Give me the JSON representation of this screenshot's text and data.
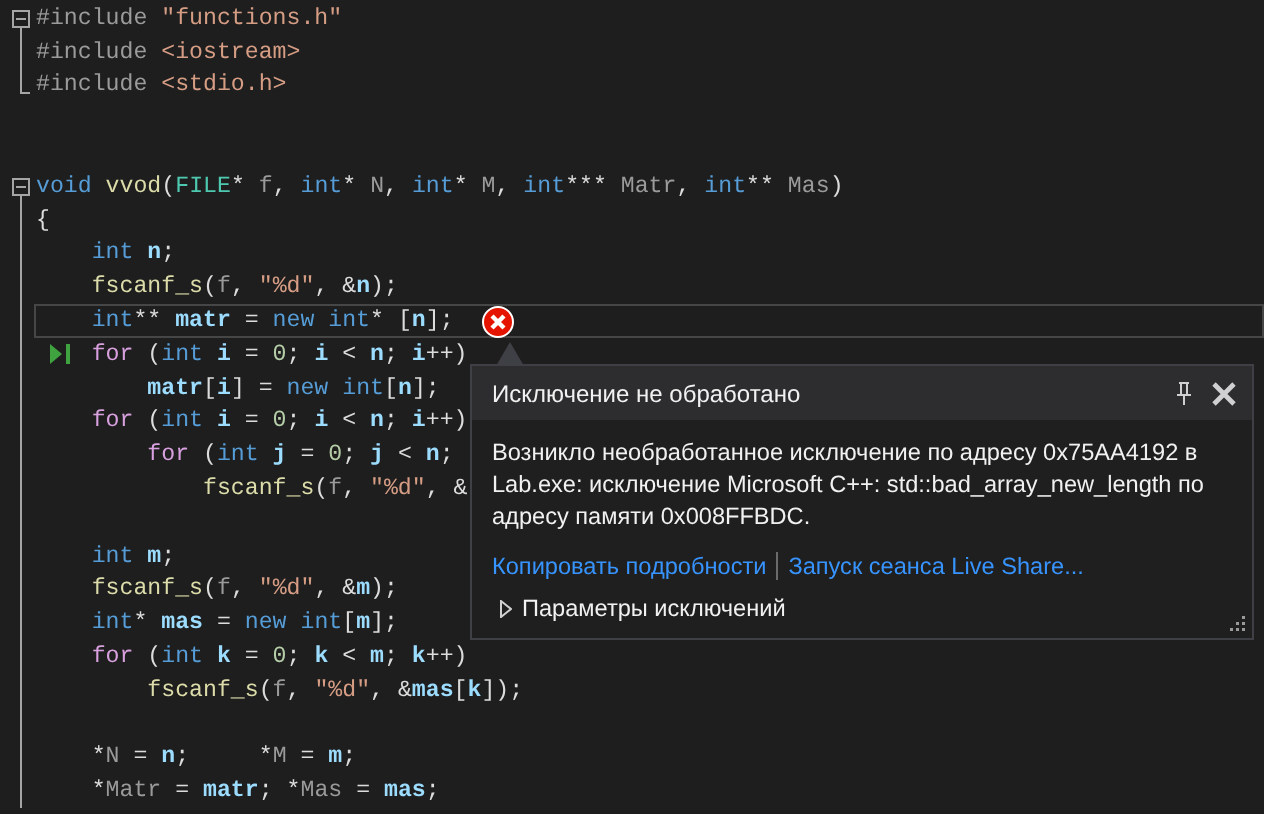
{
  "editor": {
    "lines": [
      {
        "fold": true,
        "guide": true,
        "guide_end": false,
        "highlighted": false,
        "next": false,
        "error": false,
        "tokens": [
          {
            "kind": "pre",
            "text": "#include"
          },
          {
            "kind": "str",
            "text": " \"functions.h\""
          }
        ]
      },
      {
        "fold": false,
        "guide": true,
        "guide_end": false,
        "highlighted": false,
        "next": false,
        "error": false,
        "tokens": [
          {
            "kind": "pre",
            "text": "#include"
          },
          {
            "kind": "str",
            "text": " <iostream>"
          }
        ]
      },
      {
        "fold": false,
        "guide": true,
        "guide_end": true,
        "highlighted": false,
        "next": false,
        "error": false,
        "tokens": [
          {
            "kind": "pre",
            "text": "#include"
          },
          {
            "kind": "str",
            "text": " <stdio.h>"
          }
        ]
      },
      {
        "fold": false,
        "guide": false,
        "guide_end": false,
        "highlighted": false,
        "next": false,
        "error": false
      },
      {
        "fold": false,
        "guide": false,
        "guide_end": false,
        "highlighted": false,
        "next": false,
        "error": false
      },
      {
        "fold": true,
        "guide": true,
        "guide_end": false,
        "highlighted": false,
        "next": false,
        "error": false,
        "tokens": [
          {
            "kind": "kw",
            "text": "void"
          },
          {
            "kind": "fn",
            "text": " vvod"
          },
          {
            "kind": "plain",
            "text": "("
          },
          {
            "kind": "type",
            "text": "FILE"
          },
          {
            "kind": "plain",
            "text": "*"
          },
          {
            "kind": "param",
            "text": " f"
          },
          {
            "kind": "plain",
            "text": ","
          },
          {
            "kind": "kw",
            "text": " int"
          },
          {
            "kind": "plain",
            "text": "*"
          },
          {
            "kind": "param",
            "text": " N"
          },
          {
            "kind": "plain",
            "text": ","
          },
          {
            "kind": "kw",
            "text": " int"
          },
          {
            "kind": "plain",
            "text": "*"
          },
          {
            "kind": "param",
            "text": " M"
          },
          {
            "kind": "plain",
            "text": ","
          },
          {
            "kind": "kw",
            "text": " int"
          },
          {
            "kind": "plain",
            "text": "***"
          },
          {
            "kind": "param",
            "text": " Matr"
          },
          {
            "kind": "plain",
            "text": ","
          },
          {
            "kind": "kw",
            "text": " int"
          },
          {
            "kind": "plain",
            "text": "**"
          },
          {
            "kind": "param",
            "text": " Mas"
          },
          {
            "kind": "plain",
            "text": ")"
          }
        ]
      },
      {
        "fold": false,
        "guide": true,
        "guide_end": false,
        "highlighted": false,
        "next": false,
        "error": false,
        "tokens": [
          {
            "kind": "plain",
            "text": "{"
          }
        ]
      },
      {
        "fold": false,
        "guide": true,
        "guide_end": false,
        "highlighted": false,
        "next": false,
        "error": false,
        "tokens": [
          {
            "kind": "kw",
            "text": "    int"
          },
          {
            "kind": "var",
            "text": " n"
          },
          {
            "kind": "plain",
            "text": ";"
          }
        ]
      },
      {
        "fold": false,
        "guide": true,
        "guide_end": false,
        "highlighted": false,
        "next": false,
        "error": false,
        "tokens": [
          {
            "kind": "fn",
            "text": "    fscanf_s"
          },
          {
            "kind": "plain",
            "text": "("
          },
          {
            "kind": "param",
            "text": "f"
          },
          {
            "kind": "plain",
            "text": ","
          },
          {
            "kind": "str",
            "text": " \"%d\""
          },
          {
            "kind": "plain",
            "text": ", &"
          },
          {
            "kind": "var",
            "text": "n"
          },
          {
            "kind": "plain",
            "text": ");"
          }
        ]
      },
      {
        "fold": false,
        "guide": true,
        "guide_end": false,
        "highlighted": true,
        "next": false,
        "error": true,
        "tokens": [
          {
            "kind": "kw",
            "text": "    int"
          },
          {
            "kind": "plain",
            "text": "**"
          },
          {
            "kind": "var",
            "text": " matr"
          },
          {
            "kind": "plain",
            "text": " ="
          },
          {
            "kind": "kw",
            "text": " new"
          },
          {
            "kind": "kw",
            "text": " int"
          },
          {
            "kind": "plain",
            "text": "* ["
          },
          {
            "kind": "var",
            "text": "n"
          },
          {
            "kind": "plain",
            "text": "];"
          }
        ]
      },
      {
        "fold": false,
        "guide": true,
        "guide_end": false,
        "highlighted": false,
        "next": true,
        "error": false,
        "tokens": [
          {
            "kind": "ctl",
            "text": "    for"
          },
          {
            "kind": "plain",
            "text": " ("
          },
          {
            "kind": "kw",
            "text": "int"
          },
          {
            "kind": "var",
            "text": " i"
          },
          {
            "kind": "plain",
            "text": " ="
          },
          {
            "kind": "num",
            "text": " 0"
          },
          {
            "kind": "plain",
            "text": ";"
          },
          {
            "kind": "var",
            "text": " i"
          },
          {
            "kind": "plain",
            "text": " <"
          },
          {
            "kind": "var",
            "text": " n"
          },
          {
            "kind": "plain",
            "text": ";"
          },
          {
            "kind": "var",
            "text": " i"
          },
          {
            "kind": "plain",
            "text": "++)"
          }
        ]
      },
      {
        "fold": false,
        "guide": true,
        "guide_end": false,
        "highlighted": false,
        "next": false,
        "error": false,
        "tokens": [
          {
            "kind": "var",
            "text": "        matr"
          },
          {
            "kind": "plain",
            "text": "["
          },
          {
            "kind": "var",
            "text": "i"
          },
          {
            "kind": "plain",
            "text": "] ="
          },
          {
            "kind": "kw",
            "text": " new"
          },
          {
            "kind": "kw",
            "text": " int"
          },
          {
            "kind": "plain",
            "text": "["
          },
          {
            "kind": "var",
            "text": "n"
          },
          {
            "kind": "plain",
            "text": "];"
          }
        ]
      },
      {
        "fold": false,
        "guide": true,
        "guide_end": false,
        "highlighted": false,
        "next": false,
        "error": false,
        "tokens": [
          {
            "kind": "ctl",
            "text": "    for"
          },
          {
            "kind": "plain",
            "text": " ("
          },
          {
            "kind": "kw",
            "text": "int"
          },
          {
            "kind": "var",
            "text": " i"
          },
          {
            "kind": "plain",
            "text": " ="
          },
          {
            "kind": "num",
            "text": " 0"
          },
          {
            "kind": "plain",
            "text": ";"
          },
          {
            "kind": "var",
            "text": " i"
          },
          {
            "kind": "plain",
            "text": " <"
          },
          {
            "kind": "var",
            "text": " n"
          },
          {
            "kind": "plain",
            "text": ";"
          },
          {
            "kind": "var",
            "text": " i"
          },
          {
            "kind": "plain",
            "text": "++)"
          }
        ]
      },
      {
        "fold": false,
        "guide": true,
        "guide_end": false,
        "highlighted": false,
        "next": false,
        "error": false,
        "tokens": [
          {
            "kind": "ctl",
            "text": "        for"
          },
          {
            "kind": "plain",
            "text": " ("
          },
          {
            "kind": "kw",
            "text": "int"
          },
          {
            "kind": "var",
            "text": " j"
          },
          {
            "kind": "plain",
            "text": " ="
          },
          {
            "kind": "num",
            "text": " 0"
          },
          {
            "kind": "plain",
            "text": ";"
          },
          {
            "kind": "var",
            "text": " j"
          },
          {
            "kind": "plain",
            "text": " <"
          },
          {
            "kind": "var",
            "text": " n"
          },
          {
            "kind": "plain",
            "text": ";"
          }
        ]
      },
      {
        "fold": false,
        "guide": true,
        "guide_end": false,
        "highlighted": false,
        "next": false,
        "error": false,
        "tokens": [
          {
            "kind": "fn",
            "text": "            fscanf_s"
          },
          {
            "kind": "plain",
            "text": "("
          },
          {
            "kind": "param",
            "text": "f"
          },
          {
            "kind": "plain",
            "text": ","
          },
          {
            "kind": "str",
            "text": " \"%d\""
          },
          {
            "kind": "plain",
            "text": ", &"
          }
        ]
      },
      {
        "fold": false,
        "guide": true,
        "guide_end": false,
        "highlighted": false,
        "next": false,
        "error": false
      },
      {
        "fold": false,
        "guide": true,
        "guide_end": false,
        "highlighted": false,
        "next": false,
        "error": false,
        "tokens": [
          {
            "kind": "kw",
            "text": "    int"
          },
          {
            "kind": "var",
            "text": " m"
          },
          {
            "kind": "plain",
            "text": ";"
          }
        ]
      },
      {
        "fold": false,
        "guide": true,
        "guide_end": false,
        "highlighted": false,
        "next": false,
        "error": false,
        "tokens": [
          {
            "kind": "fn",
            "text": "    fscanf_s"
          },
          {
            "kind": "plain",
            "text": "("
          },
          {
            "kind": "param",
            "text": "f"
          },
          {
            "kind": "plain",
            "text": ","
          },
          {
            "kind": "str",
            "text": " \"%d\""
          },
          {
            "kind": "plain",
            "text": ", &"
          },
          {
            "kind": "var",
            "text": "m"
          },
          {
            "kind": "plain",
            "text": ");"
          }
        ]
      },
      {
        "fold": false,
        "guide": true,
        "guide_end": false,
        "highlighted": false,
        "next": false,
        "error": false,
        "tokens": [
          {
            "kind": "kw",
            "text": "    int"
          },
          {
            "kind": "plain",
            "text": "*"
          },
          {
            "kind": "var",
            "text": " mas"
          },
          {
            "kind": "plain",
            "text": " ="
          },
          {
            "kind": "kw",
            "text": " new"
          },
          {
            "kind": "kw",
            "text": " int"
          },
          {
            "kind": "plain",
            "text": "["
          },
          {
            "kind": "var",
            "text": "m"
          },
          {
            "kind": "plain",
            "text": "];"
          }
        ]
      },
      {
        "fold": false,
        "guide": true,
        "guide_end": false,
        "highlighted": false,
        "next": false,
        "error": false,
        "tokens": [
          {
            "kind": "ctl",
            "text": "    for"
          },
          {
            "kind": "plain",
            "text": " ("
          },
          {
            "kind": "kw",
            "text": "int"
          },
          {
            "kind": "var",
            "text": " k"
          },
          {
            "kind": "plain",
            "text": " ="
          },
          {
            "kind": "num",
            "text": " 0"
          },
          {
            "kind": "plain",
            "text": ";"
          },
          {
            "kind": "var",
            "text": " k"
          },
          {
            "kind": "plain",
            "text": " <"
          },
          {
            "kind": "var",
            "text": " m"
          },
          {
            "kind": "plain",
            "text": ";"
          },
          {
            "kind": "var",
            "text": " k"
          },
          {
            "kind": "plain",
            "text": "++)"
          }
        ]
      },
      {
        "fold": false,
        "guide": true,
        "guide_end": false,
        "highlighted": false,
        "next": false,
        "error": false,
        "tokens": [
          {
            "kind": "fn",
            "text": "        fscanf_s"
          },
          {
            "kind": "plain",
            "text": "("
          },
          {
            "kind": "param",
            "text": "f"
          },
          {
            "kind": "plain",
            "text": ","
          },
          {
            "kind": "str",
            "text": " \"%d\""
          },
          {
            "kind": "plain",
            "text": ", &"
          },
          {
            "kind": "var",
            "text": "mas"
          },
          {
            "kind": "plain",
            "text": "["
          },
          {
            "kind": "var",
            "text": "k"
          },
          {
            "kind": "plain",
            "text": "]);"
          }
        ]
      },
      {
        "fold": false,
        "guide": true,
        "guide_end": false,
        "highlighted": false,
        "next": false,
        "error": false
      },
      {
        "fold": false,
        "guide": true,
        "guide_end": false,
        "highlighted": false,
        "next": false,
        "error": false,
        "tokens": [
          {
            "kind": "plain",
            "text": "    *"
          },
          {
            "kind": "param",
            "text": "N"
          },
          {
            "kind": "plain",
            "text": " ="
          },
          {
            "kind": "var",
            "text": " n"
          },
          {
            "kind": "plain",
            "text": ";     *"
          },
          {
            "kind": "param",
            "text": "M"
          },
          {
            "kind": "plain",
            "text": " ="
          },
          {
            "kind": "var",
            "text": " m"
          },
          {
            "kind": "plain",
            "text": ";"
          }
        ]
      },
      {
        "fold": false,
        "guide": true,
        "guide_end": false,
        "highlighted": false,
        "next": false,
        "error": false,
        "tokens": [
          {
            "kind": "plain",
            "text": "    *"
          },
          {
            "kind": "param",
            "text": "Matr"
          },
          {
            "kind": "plain",
            "text": " ="
          },
          {
            "kind": "var",
            "text": " matr"
          },
          {
            "kind": "plain",
            "text": "; *"
          },
          {
            "kind": "param",
            "text": "Mas"
          },
          {
            "kind": "plain",
            "text": " ="
          },
          {
            "kind": "var",
            "text": " mas"
          },
          {
            "kind": "plain",
            "text": ";"
          }
        ]
      }
    ]
  },
  "exception_popup": {
    "title": "Исключение не обработано",
    "message": "Возникло необработанное исключение по адресу 0x75AA4192 в Lab.exe: исключение Microsoft C++: std::bad_array_new_length по адресу памяти 0x008FFBDC.",
    "links": [
      "Копировать подробности",
      "Запуск сеанса Live Share..."
    ],
    "settings": {
      "label": "Параметры исключений",
      "expanded": false
    }
  }
}
